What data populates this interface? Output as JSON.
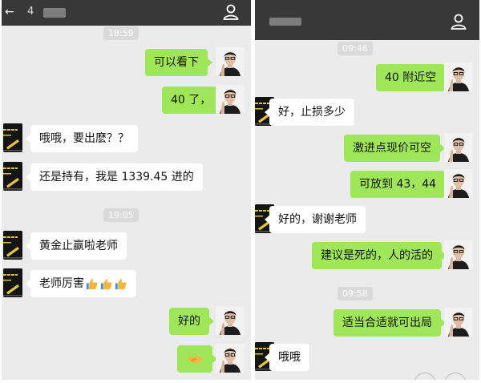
{
  "left": {
    "title": "4",
    "messages": [
      {
        "type": "time",
        "text": "18:59"
      },
      {
        "type": "me",
        "text": "可以看下"
      },
      {
        "type": "me",
        "text": "40 了，"
      },
      {
        "type": "them",
        "text": "哦哦，要出麽？？"
      },
      {
        "type": "them",
        "text": "还是持有，我是 1339.45 进的"
      },
      {
        "type": "time",
        "text": "19:05"
      },
      {
        "type": "them",
        "text": "黄金止赢啦老师"
      },
      {
        "type": "them",
        "text": "老师厉害",
        "emoji": "thumbs-up x3"
      },
      {
        "type": "me",
        "text": "好的"
      },
      {
        "type": "me",
        "text": "",
        "emoji": "handshake"
      }
    ]
  },
  "right": {
    "title": "",
    "messages": [
      {
        "type": "time",
        "text": "09:46"
      },
      {
        "type": "me",
        "text": "40 附近空"
      },
      {
        "type": "them",
        "text": "好，止损多少"
      },
      {
        "type": "me",
        "text": "激进点现价可空"
      },
      {
        "type": "me",
        "text": "可放到 43，44"
      },
      {
        "type": "them",
        "text": "好的，谢谢老师"
      },
      {
        "type": "me",
        "text": "建议是死的，人的活的"
      },
      {
        "type": "time",
        "text": "09:58"
      },
      {
        "type": "me",
        "text": "适当合适就可出局"
      },
      {
        "type": "them",
        "text": "哦哦"
      }
    ]
  },
  "colors": {
    "header": "#383838",
    "chat_bg": "#ebebeb",
    "my_bubble": "#9fe658",
    "their_bubble": "#ffffff",
    "timestamp_bg": "#dadada"
  }
}
